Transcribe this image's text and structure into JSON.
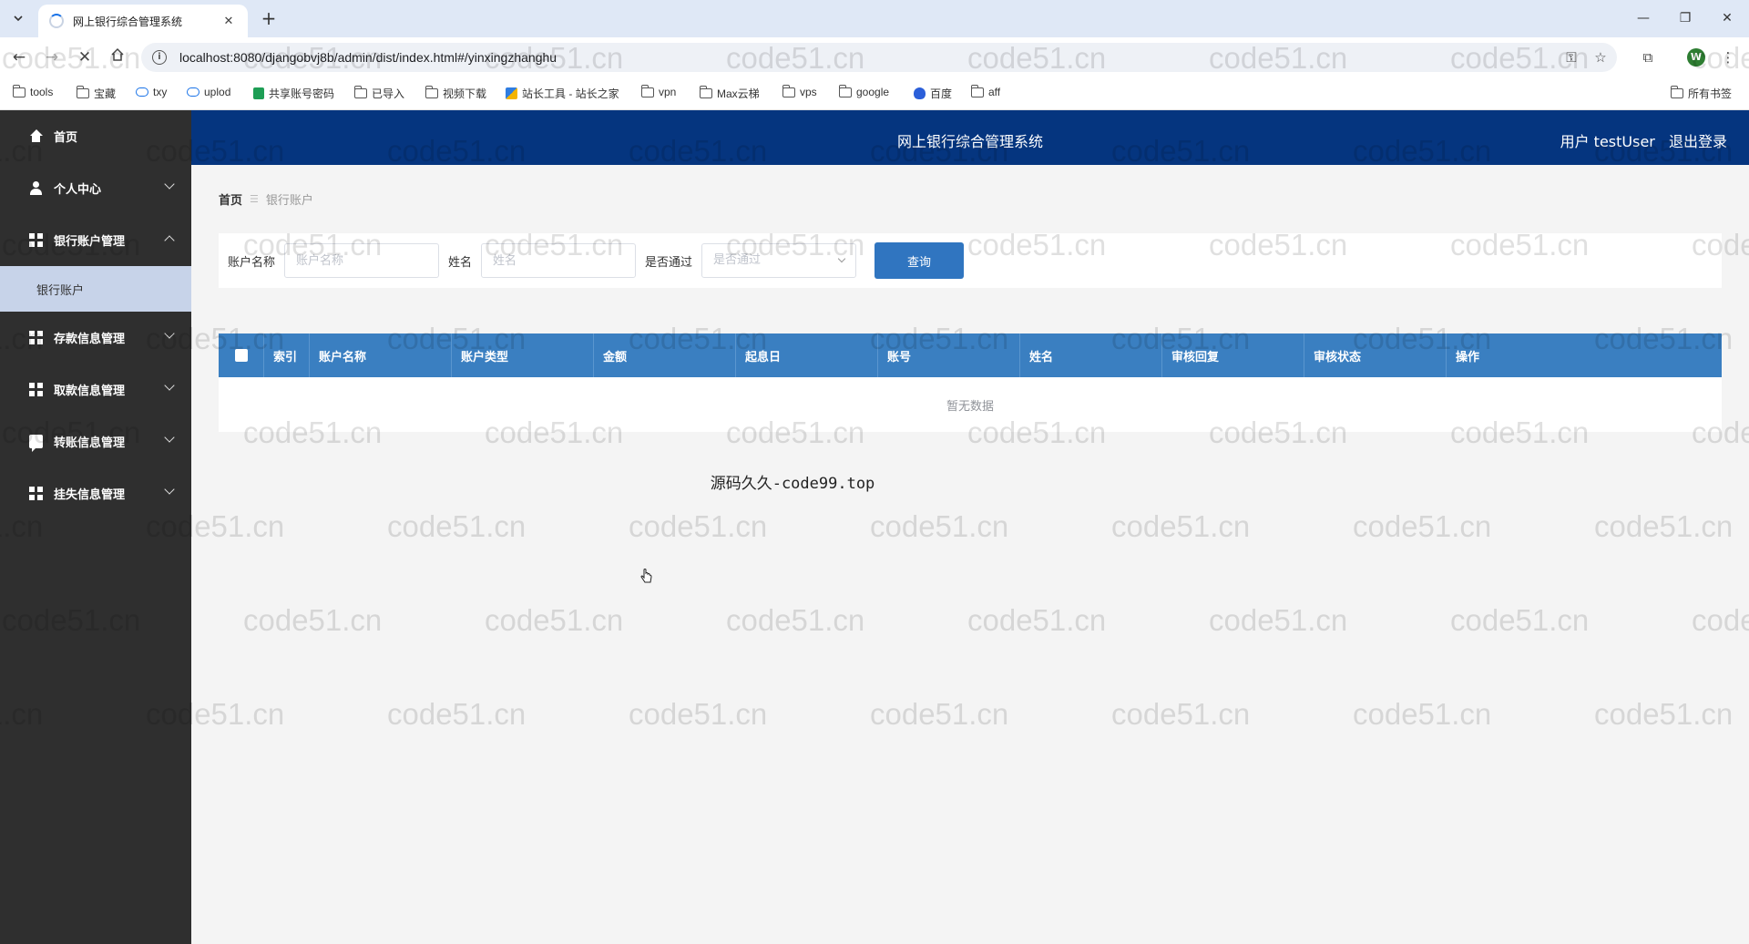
{
  "browser": {
    "tab_title": "网上银行综合管理系统",
    "url": "localhost:8080/djangobvj8b/admin/dist/index.html#/yinxingzhanghu",
    "profile_initial": "W",
    "bookmarks": [
      {
        "label": "tools",
        "icon": "folder-icon"
      },
      {
        "label": "宝藏",
        "icon": "folder-icon"
      },
      {
        "label": "txy",
        "icon": "cloud-icon"
      },
      {
        "label": "uplod",
        "icon": "cloud-icon"
      },
      {
        "label": "共享账号密码",
        "icon": "sheet-icon"
      },
      {
        "label": "已导入",
        "icon": "folder-icon"
      },
      {
        "label": "视频下载",
        "icon": "folder-icon"
      },
      {
        "label": "站长工具 - 站长之家",
        "icon": "tool-icon"
      },
      {
        "label": "vpn",
        "icon": "folder-icon"
      },
      {
        "label": "Max云梯",
        "icon": "folder-icon"
      },
      {
        "label": "vps",
        "icon": "folder-icon"
      },
      {
        "label": "google",
        "icon": "folder-icon"
      },
      {
        "label": "百度",
        "icon": "paw-icon"
      },
      {
        "label": "aff",
        "icon": "folder-icon"
      }
    ],
    "all_bookmarks": "所有书签"
  },
  "sidebar": {
    "items": [
      {
        "label": "首页",
        "icon": "home-icon"
      },
      {
        "label": "个人中心",
        "icon": "user-icon"
      },
      {
        "label": "银行账户管理",
        "icon": "grid-icon",
        "expanded": true
      },
      {
        "label": "存款信息管理",
        "icon": "grid-icon"
      },
      {
        "label": "取款信息管理",
        "icon": "grid-icon"
      },
      {
        "label": "转账信息管理",
        "icon": "chat-icon"
      },
      {
        "label": "挂失信息管理",
        "icon": "grid-icon"
      }
    ],
    "submenu": {
      "label": "银行账户"
    }
  },
  "header": {
    "title": "网上银行综合管理系统",
    "user_label": "用户 testUser",
    "logout": "退出登录"
  },
  "breadcrumb": {
    "home": "首页",
    "current": "银行账户"
  },
  "search": {
    "account_name_label": "账户名称",
    "account_name_placeholder": "账户名称",
    "name_label": "姓名",
    "name_placeholder": "姓名",
    "passed_label": "是否通过",
    "passed_placeholder": "是否通过",
    "button": "查询"
  },
  "table": {
    "columns": [
      "索引",
      "账户名称",
      "账户类型",
      "金额",
      "起息日",
      "账号",
      "姓名",
      "审核回复",
      "审核状态",
      "操作"
    ],
    "empty_text": "暂无数据"
  },
  "footer_note": "源码久久-code99.top",
  "watermark": "code51.cn",
  "colors": {
    "header_bg": "#05357f",
    "sidebar_bg": "#2f2f2f",
    "table_header_bg": "#3a7fc1",
    "button_bg": "#3075c0",
    "submenu_active_bg": "#c7d3e9"
  }
}
